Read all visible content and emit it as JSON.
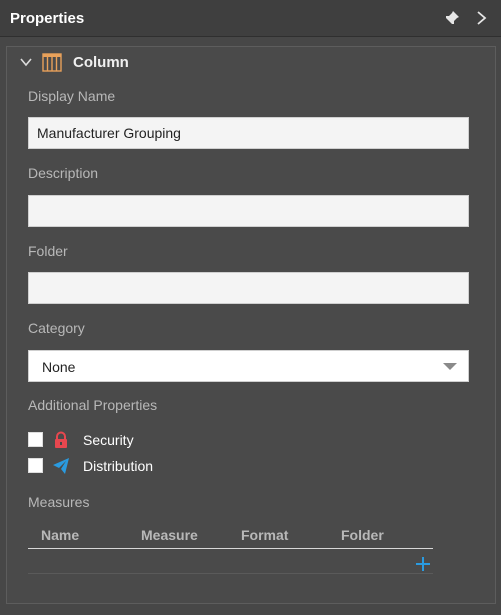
{
  "header": {
    "title": "Properties",
    "pin_icon": "pin-icon",
    "collapse_icon": "chevron-right-icon"
  },
  "group": {
    "title": "Column",
    "icon": "column-icon",
    "toggle_icon": "chevron-down-icon"
  },
  "fields": {
    "display_name": {
      "label": "Display Name",
      "value": "Manufacturer Grouping"
    },
    "description": {
      "label": "Description",
      "value": ""
    },
    "folder": {
      "label": "Folder",
      "value": ""
    },
    "category": {
      "label": "Category",
      "selected": "None"
    }
  },
  "additional": {
    "label": "Additional Properties",
    "options": [
      {
        "label": "Security",
        "checked": false,
        "icon": "lock-icon",
        "color": "#e8474f"
      },
      {
        "label": "Distribution",
        "checked": false,
        "icon": "paper-plane-icon",
        "color": "#2a9be0"
      }
    ]
  },
  "measures": {
    "label": "Measures",
    "columns": [
      "Name",
      "Measure",
      "Format",
      "Folder"
    ],
    "rows": [],
    "add_icon": "plus-icon"
  },
  "colors": {
    "accent": "#2a9be0",
    "folder_icon": "#e8a15a",
    "panel": "#474747"
  }
}
